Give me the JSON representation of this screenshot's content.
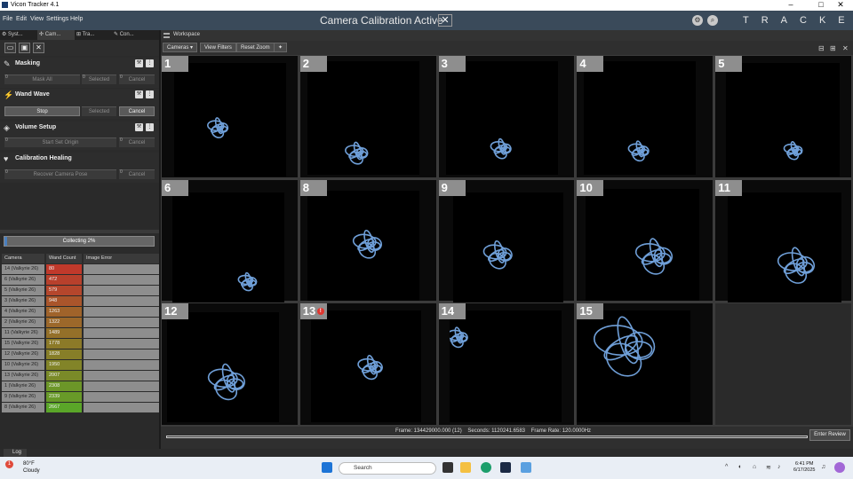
{
  "window": {
    "title": "Vicon Tracker 4.1",
    "minimize": "–",
    "maximize": "□",
    "close": "✕"
  },
  "menu": {
    "items": [
      "File",
      "Edit",
      "View",
      "Settings",
      "Help"
    ],
    "banner": "Camera Calibration Active",
    "brand": "TRACKER"
  },
  "left_tabs": [
    "Syst...",
    "Cam...",
    "Tra...",
    "Con..."
  ],
  "sections": {
    "masking": {
      "title": "Masking",
      "buttons": [
        "Mask All",
        "Selected",
        "Cancel"
      ],
      "nums": [
        "0",
        "0",
        "0"
      ]
    },
    "wand_wave": {
      "title": "Wand Wave",
      "buttons": [
        "Stop",
        "Selected",
        "Cancel"
      ]
    },
    "volume_setup": {
      "title": "Volume Setup",
      "buttons": [
        "Start Set Origin",
        "Cancel"
      ],
      "nums": [
        "0",
        "0"
      ]
    },
    "calibration_healing": {
      "title": "Calibration Healing",
      "buttons": [
        "Recover Camera Pose",
        "Cancel"
      ],
      "nums": [
        "0",
        "0"
      ]
    }
  },
  "progress": {
    "label": "Collecting 2%",
    "percent": 2
  },
  "camera_table": {
    "headers": [
      "Camera",
      "Wand Count",
      "Image Error"
    ],
    "rows": [
      {
        "camera": "14 (Valkyrie 26)",
        "count": "80",
        "color": "#c0392b"
      },
      {
        "camera": "6 (Valkyrie 26)",
        "count": "472",
        "color": "#b8402c"
      },
      {
        "camera": "5 (Valkyrie 26)",
        "count": "579",
        "color": "#b5462c"
      },
      {
        "camera": "3 (Valkyrie 26)",
        "count": "948",
        "color": "#aa552b"
      },
      {
        "camera": "4 (Valkyrie 26)",
        "count": "1263",
        "color": "#a0632a"
      },
      {
        "camera": "2 (Valkyrie 26)",
        "count": "1322",
        "color": "#9c682a"
      },
      {
        "camera": "11 (Valkyrie 26)",
        "count": "1489",
        "color": "#947029"
      },
      {
        "camera": "15 (Valkyrie 26)",
        "count": "1778",
        "color": "#8c7a28"
      },
      {
        "camera": "12 (Valkyrie 26)",
        "count": "1828",
        "color": "#877e28"
      },
      {
        "camera": "10 (Valkyrie 26)",
        "count": "1950",
        "color": "#828428"
      },
      {
        "camera": "13 (Valkyrie 26)",
        "count": "2007",
        "color": "#7a8a28"
      },
      {
        "camera": "1 (Valkyrie 26)",
        "count": "2308",
        "color": "#6c9628"
      },
      {
        "camera": "9 (Valkyrie 26)",
        "count": "2339",
        "color": "#689a28"
      },
      {
        "camera": "8 (Valkyrie 26)",
        "count": "2667",
        "color": "#5aa628"
      }
    ]
  },
  "log_tab": "Log",
  "workspace": {
    "title": "Workspace",
    "cameras_btn": "Cameras",
    "view_filters": "View Filters",
    "reset_zoom": "Reset Zoom"
  },
  "cameras": [
    "1",
    "2",
    "3",
    "4",
    "5",
    "6",
    "8",
    "9",
    "10",
    "11",
    "12",
    "13",
    "14",
    "15"
  ],
  "status": {
    "frame": "Frame: 134429000.000 (12)",
    "seconds": "Seconds: 1120241.6583",
    "rate": "Frame Rate: 120.0000Hz",
    "enter_review": "Enter Review"
  },
  "taskbar": {
    "temp": "80°F",
    "weather": "Cloudy",
    "search": "Search",
    "time": "6:41 PM",
    "date": "6/17/2025",
    "badge": "1"
  }
}
